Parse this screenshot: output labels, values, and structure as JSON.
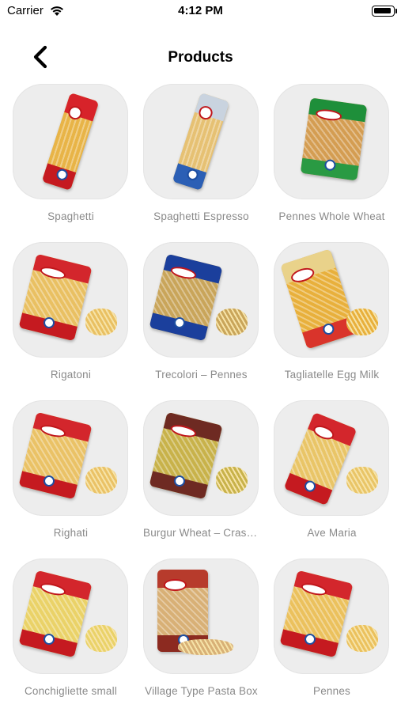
{
  "status_bar": {
    "carrier": "Carrier",
    "time": "4:12 PM"
  },
  "nav": {
    "title": "Products",
    "back_icon": "chevron-left-icon"
  },
  "products": [
    {
      "name": "Spaghetti",
      "pack_color": "#d7232a",
      "fill_color": "#e8b447",
      "shape": "long",
      "band": "#c51a20"
    },
    {
      "name": "Spaghetti Espresso",
      "pack_color": "#c9d3df",
      "fill_color": "#e6c173",
      "shape": "long",
      "band": "#2b5fb5"
    },
    {
      "name": "Pennes Whole Wheat",
      "pack_color": "#1e8f3a",
      "fill_color": "#d49d52",
      "shape": "bag",
      "band": "#2a9a43"
    },
    {
      "name": "Rigatoni",
      "pack_color": "#d3262c",
      "fill_color": "#e9c062",
      "shape": "bag",
      "band": "#c51a20"
    },
    {
      "name": "Trecolori – Pennes",
      "pack_color": "#1b3f9c",
      "fill_color": "#c9a55a",
      "shape": "bag",
      "band": "#1b3f9c"
    },
    {
      "name": "Tagliatelle Egg Milk",
      "pack_color": "#e9d28a",
      "fill_color": "#e8b03c",
      "shape": "wide",
      "band": "#d9342b"
    },
    {
      "name": "Righati",
      "pack_color": "#d3262c",
      "fill_color": "#eac266",
      "shape": "bag",
      "band": "#c51a20"
    },
    {
      "name": "Burgur Wheat – Crashed",
      "pack_color": "#6e2a22",
      "fill_color": "#c8b24a",
      "shape": "bag",
      "band": "#6e2a22"
    },
    {
      "name": "Ave Maria",
      "pack_color": "#d3262c",
      "fill_color": "#e9c567",
      "shape": "tilt",
      "band": "#c51a20"
    },
    {
      "name": "Conchigliette small",
      "pack_color": "#d3262c",
      "fill_color": "#ead268",
      "shape": "bag",
      "band": "#c51a20"
    },
    {
      "name": "Village Type Pasta Box",
      "pack_color": "#b73b2c",
      "fill_color": "#d8b076",
      "shape": "box",
      "band": "#8c2a20"
    },
    {
      "name": "Pennes",
      "pack_color": "#d3262c",
      "fill_color": "#ebc15d",
      "shape": "bag",
      "band": "#c51a20"
    }
  ]
}
